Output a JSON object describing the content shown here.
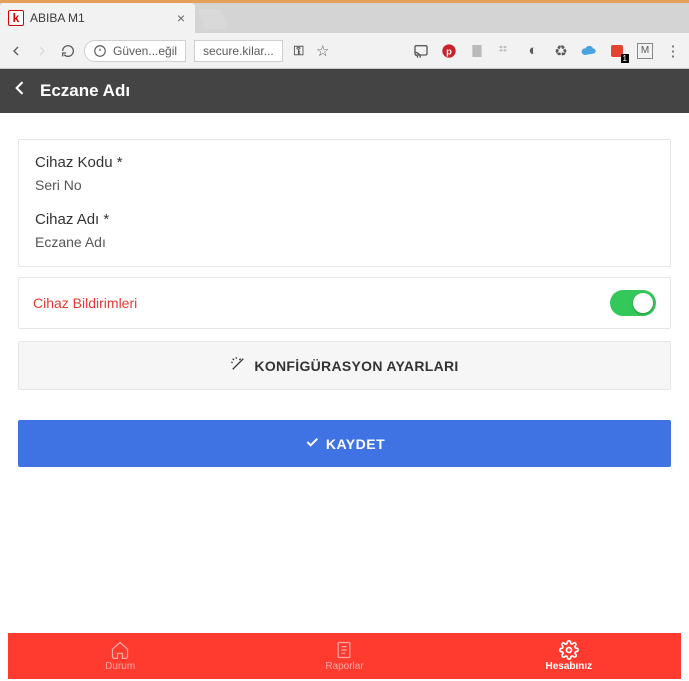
{
  "browser": {
    "tab_title": "ABIBA M1",
    "security_text": "Güven...eğil",
    "address": "secure.kilar..."
  },
  "header": {
    "title": "Eczane Adı"
  },
  "form": {
    "device_code_label": "Cihaz Kodu *",
    "device_code_value": "Seri No",
    "device_name_label": "Cihaz Adı *",
    "device_name_value": "Eczane Adı"
  },
  "notifications": {
    "label": "Cihaz Bildirimleri",
    "enabled": true
  },
  "buttons": {
    "config_label": "KONFİGÜRASYON AYARLARI",
    "save_label": "KAYDET"
  },
  "bottom_nav": {
    "items": [
      {
        "label": "Durum"
      },
      {
        "label": "Raporlar"
      },
      {
        "label": "Hesabınız"
      }
    ],
    "active_index": 2
  }
}
